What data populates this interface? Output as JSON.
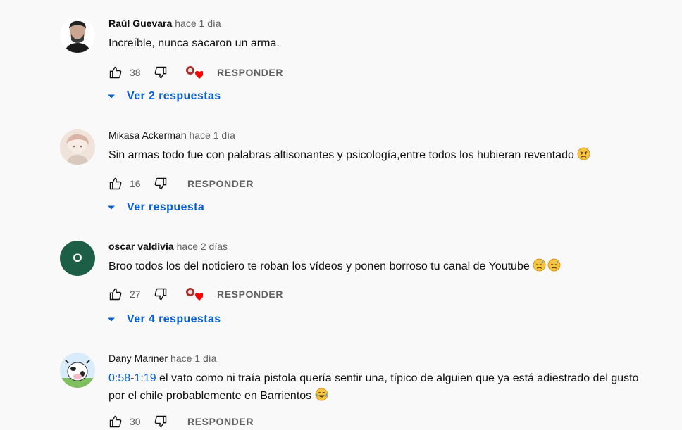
{
  "comments": [
    {
      "author": "Raúl Guevara",
      "time": "hace 1 día",
      "text": "Increíble, nunca sacaron un arma.",
      "likes": "38",
      "reply_label": "RESPONDER",
      "replies_label": "Ver 2 respuestas",
      "creator_heart": true
    },
    {
      "author": "Mikasa Ackerman",
      "time": "hace 1 día",
      "text": "Sin armas todo fue con palabras altisonantes y psicología,entre todos los hubieran reventado",
      "likes": "16",
      "reply_label": "RESPONDER",
      "replies_label": "Ver respuesta",
      "creator_heart": false
    },
    {
      "author": "oscar valdivia",
      "time": "hace 2 días",
      "avatar_letter": "O",
      "text": "Broo todos los del noticiero te roban los vídeos y ponen borroso tu canal de Youtube",
      "likes": "27",
      "reply_label": "RESPONDER",
      "replies_label": "Ver 4 respuestas",
      "creator_heart": true
    },
    {
      "author": "Dany Mariner",
      "time": "hace 1 día",
      "timestamp_start": "0:58",
      "timestamp_sep": "-",
      "timestamp_end": "1:19",
      "text": " el vato como ni traía pistola quería sentir una, típico de alguien que ya está adiestrado del gusto por el chile probablemente en Barrientos",
      "likes": "30",
      "reply_label": "RESPONDER"
    }
  ],
  "colors": {
    "link_blue": "#065fd4",
    "secondary_text": "#606060",
    "background": "#f9f9f9",
    "heart_red": "#ff0000",
    "avatar_green": "#1c5e46"
  },
  "icons": [
    "like-icon",
    "dislike-icon",
    "creator-heart-icon",
    "chevron-down-icon",
    "angry-emoji-icon",
    "sad-emoji-icon",
    "laughing-emoji-icon"
  ]
}
